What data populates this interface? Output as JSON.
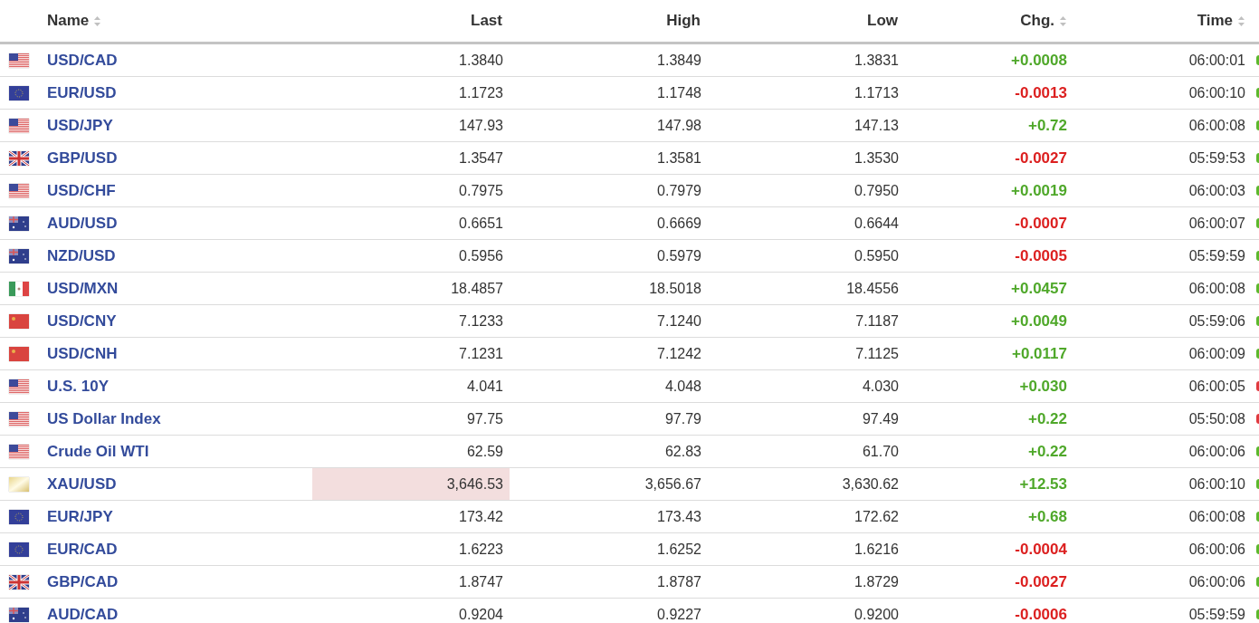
{
  "columns": [
    {
      "label": "Name",
      "sortable": true
    },
    {
      "label": "Last",
      "sortable": false
    },
    {
      "label": "High",
      "sortable": false
    },
    {
      "label": "Low",
      "sortable": false
    },
    {
      "label": "Chg.",
      "sortable": true
    },
    {
      "label": "Time",
      "sortable": true
    }
  ],
  "rows": [
    {
      "flag": {
        "kind": "us"
      },
      "name": "USD/CAD",
      "last": "1.3840",
      "high": "1.3849",
      "low": "1.3831",
      "change": {
        "text": "+0.0008",
        "kind": "up"
      },
      "time": "06:00:01",
      "color": "#5cb82c",
      "highlighted": false
    },
    {
      "flag": {
        "kind": "eu"
      },
      "name": "EUR/USD",
      "last": "1.1723",
      "high": "1.1748",
      "low": "1.1713",
      "change": {
        "text": "-0.0013",
        "kind": "down"
      },
      "time": "06:00:10",
      "color": "#5cb82c",
      "highlighted": false
    },
    {
      "flag": {
        "kind": "us"
      },
      "name": "USD/JPY",
      "last": "147.93",
      "high": "147.98",
      "low": "147.13",
      "change": {
        "text": "+0.72",
        "kind": "up"
      },
      "time": "06:00:08",
      "color": "#5cb82c",
      "highlighted": false
    },
    {
      "flag": {
        "kind": "gb"
      },
      "name": "GBP/USD",
      "last": "1.3547",
      "high": "1.3581",
      "low": "1.3530",
      "change": {
        "text": "-0.0027",
        "kind": "down"
      },
      "time": "05:59:53",
      "color": "#5cb82c",
      "highlighted": false
    },
    {
      "flag": {
        "kind": "us"
      },
      "name": "USD/CHF",
      "last": "0.7975",
      "high": "0.7979",
      "low": "0.7950",
      "change": {
        "text": "+0.0019",
        "kind": "up"
      },
      "time": "06:00:03",
      "color": "#5cb82c",
      "highlighted": false
    },
    {
      "flag": {
        "kind": "au"
      },
      "name": "AUD/USD",
      "last": "0.6651",
      "high": "0.6669",
      "low": "0.6644",
      "change": {
        "text": "-0.0007",
        "kind": "down"
      },
      "time": "06:00:07",
      "color": "#5cb82c",
      "highlighted": false
    },
    {
      "flag": {
        "kind": "au"
      },
      "name": "NZD/USD",
      "last": "0.5956",
      "high": "0.5979",
      "low": "0.5950",
      "change": {
        "text": "-0.0005",
        "kind": "down"
      },
      "time": "05:59:59",
      "color": "#5cb82c",
      "highlighted": false
    },
    {
      "flag": {
        "kind": "mx"
      },
      "name": "USD/MXN",
      "last": "18.4857",
      "high": "18.5018",
      "low": "18.4556",
      "change": {
        "text": "+0.0457",
        "kind": "up"
      },
      "time": "06:00:08",
      "color": "#5cb82c",
      "highlighted": false
    },
    {
      "flag": {
        "kind": "cn"
      },
      "name": "USD/CNY",
      "last": "7.1233",
      "high": "7.1240",
      "low": "7.1187",
      "change": {
        "text": "+0.0049",
        "kind": "up"
      },
      "time": "05:59:06",
      "color": "#5cb82c",
      "highlighted": false
    },
    {
      "flag": {
        "kind": "cn"
      },
      "name": "USD/CNH",
      "last": "7.1231",
      "high": "7.1242",
      "low": "7.1125",
      "change": {
        "text": "+0.0117",
        "kind": "up"
      },
      "time": "06:00:09",
      "color": "#5cb82c",
      "highlighted": false
    },
    {
      "flag": {
        "kind": "us"
      },
      "name": "U.S. 10Y",
      "last": "4.041",
      "high": "4.048",
      "low": "4.030",
      "change": {
        "text": "+0.030",
        "kind": "up"
      },
      "time": "06:00:05",
      "color": "#e0393e",
      "highlighted": false
    },
    {
      "flag": {
        "kind": "us"
      },
      "name": "US Dollar Index",
      "last": "97.75",
      "high": "97.79",
      "low": "97.49",
      "change": {
        "text": "+0.22",
        "kind": "up"
      },
      "time": "05:50:08",
      "color": "#e0393e",
      "highlighted": false
    },
    {
      "flag": {
        "kind": "us"
      },
      "name": "Crude Oil WTI",
      "last": "62.59",
      "high": "62.83",
      "low": "61.70",
      "change": {
        "text": "+0.22",
        "kind": "up"
      },
      "time": "06:00:06",
      "color": "#5cb82c",
      "highlighted": false
    },
    {
      "flag": {
        "kind": "gold"
      },
      "name": "XAU/USD",
      "last": "3,646.53",
      "high": "3,656.67",
      "low": "3,630.62",
      "change": {
        "text": "+12.53",
        "kind": "up"
      },
      "time": "06:00:10",
      "color": "#5cb82c",
      "highlighted": true
    },
    {
      "flag": {
        "kind": "eu"
      },
      "name": "EUR/JPY",
      "last": "173.42",
      "high": "173.43",
      "low": "172.62",
      "change": {
        "text": "+0.68",
        "kind": "up"
      },
      "time": "06:00:08",
      "color": "#5cb82c",
      "highlighted": false
    },
    {
      "flag": {
        "kind": "eu"
      },
      "name": "EUR/CAD",
      "last": "1.6223",
      "high": "1.6252",
      "low": "1.6216",
      "change": {
        "text": "-0.0004",
        "kind": "down"
      },
      "time": "06:00:06",
      "color": "#5cb82c",
      "highlighted": false
    },
    {
      "flag": {
        "kind": "gb"
      },
      "name": "GBP/CAD",
      "last": "1.8747",
      "high": "1.8787",
      "low": "1.8729",
      "change": {
        "text": "-0.0027",
        "kind": "down"
      },
      "time": "06:00:06",
      "color": "#5cb82c",
      "highlighted": false
    },
    {
      "flag": {
        "kind": "au"
      },
      "name": "AUD/CAD",
      "last": "0.9204",
      "high": "0.9227",
      "low": "0.9200",
      "change": {
        "text": "-0.0006",
        "kind": "down"
      },
      "time": "05:59:59",
      "color": "#5cb82c",
      "highlighted": false
    }
  ]
}
